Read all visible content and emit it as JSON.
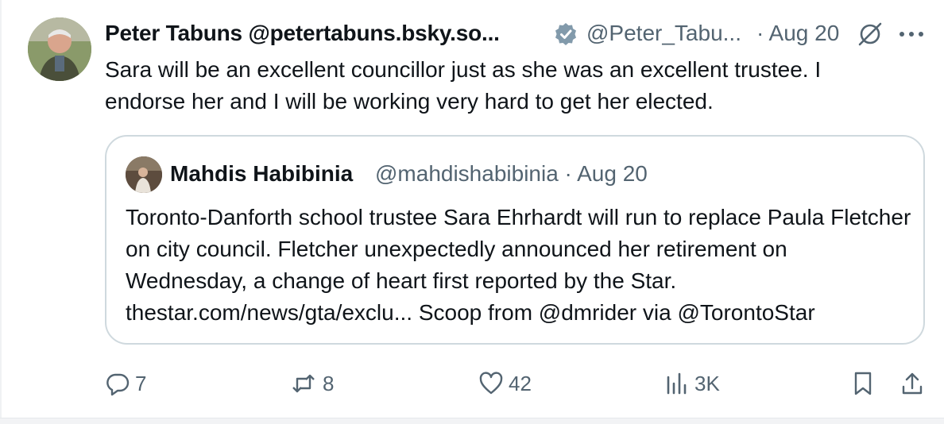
{
  "post": {
    "author_name": "Peter Tabuns @petertabuns.bsky.so...",
    "author_handle": "@Peter_Tabu...",
    "date": "· Aug 20",
    "text": "Sara will be an excellent councillor just as she was an excellent trustee. I endorse her and I will be working very hard to get her elected."
  },
  "quote": {
    "author_name": "Mahdis Habibinia",
    "author_handle": "@mahdishabibinia · Aug 20",
    "text": "Toronto-Danforth school trustee Sara Ehrhardt will run to replace Paula Fletcher on city council. Fletcher unexpectedly announced her retirement on Wednesday, a change of heart first reported by the Star. thestar.com/news/gta/exclu... Scoop from @dmrider via @TorontoStar"
  },
  "actions": {
    "replies": "7",
    "reposts": "8",
    "likes": "42",
    "views": "3K"
  },
  "icons": {
    "verified": "verified-badge-icon",
    "grok": "grok-icon",
    "more": "more-icon",
    "reply": "reply-icon",
    "repost": "repost-icon",
    "like": "like-icon",
    "views": "views-icon",
    "bookmark": "bookmark-icon",
    "share": "share-icon"
  },
  "colors": {
    "text": "#0f1419",
    "muted": "#536471",
    "border": "#cfd9de"
  }
}
